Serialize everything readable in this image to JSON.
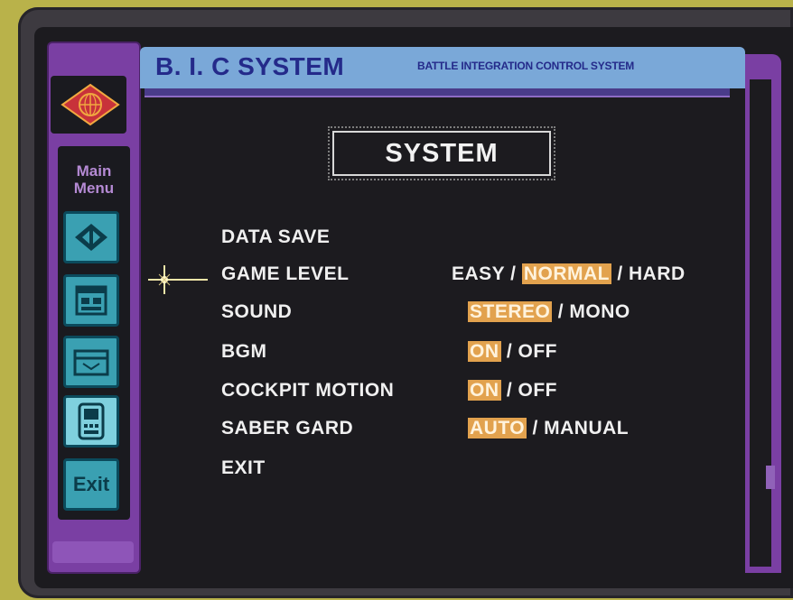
{
  "header": {
    "title": "B. I. C SYSTEM",
    "subtitle": "BATTLE INTEGRATION CONTROL SYSTEM"
  },
  "sidebar": {
    "menu_label_line1": "Main",
    "menu_label_line2": "Menu",
    "buttons": [
      {
        "icon": "diamond-arrows-icon"
      },
      {
        "icon": "window-icon"
      },
      {
        "icon": "folder-icon"
      },
      {
        "icon": "handheld-device-icon",
        "active": true
      },
      {
        "icon": "exit-icon",
        "label": "Exit"
      }
    ]
  },
  "screen": {
    "title": "SYSTEM",
    "rows": [
      {
        "label": "DATA SAVE",
        "options": []
      },
      {
        "label": "GAME LEVEL",
        "options": [
          "EASY",
          "NORMAL",
          "HARD"
        ],
        "selected": "NORMAL"
      },
      {
        "label": "SOUND",
        "options": [
          "STEREO",
          "MONO"
        ],
        "selected": "STEREO"
      },
      {
        "label": "BGM",
        "options": [
          "ON",
          "OFF"
        ],
        "selected": "ON"
      },
      {
        "label": "COCKPIT MOTION",
        "options": [
          "ON",
          "OFF"
        ],
        "selected": "ON"
      },
      {
        "label": "SABER GARD",
        "options": [
          "AUTO",
          "MANUAL"
        ],
        "selected": "AUTO"
      },
      {
        "label": "EXIT",
        "options": []
      }
    ],
    "cursor_row": "GAME LEVEL",
    "separator": "/"
  },
  "colors": {
    "background": "#1c1b1f",
    "frame_purple": "#7a3fa3",
    "header_blue": "#7aa8d8",
    "header_text": "#242a8a",
    "selected_option": "#e2a24e",
    "menu_button": "#3aa0b2"
  }
}
